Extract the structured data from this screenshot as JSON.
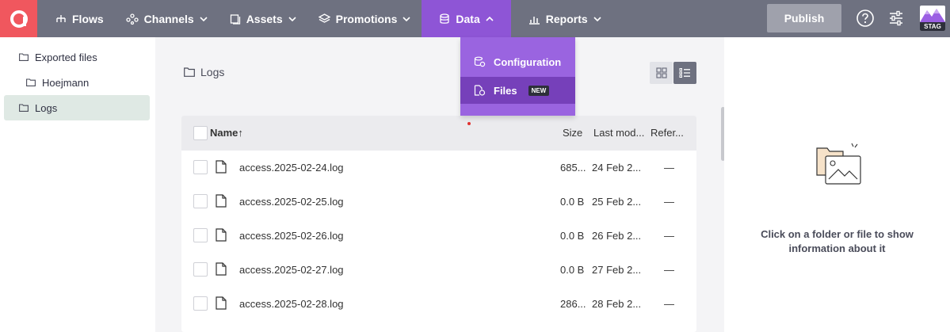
{
  "nav": {
    "items": [
      {
        "label": "Flows",
        "icon": "flows-icon"
      },
      {
        "label": "Channels",
        "icon": "channels-icon"
      },
      {
        "label": "Assets",
        "icon": "assets-icon"
      },
      {
        "label": "Promotions",
        "icon": "promotions-icon"
      },
      {
        "label": "Data",
        "icon": "database-icon",
        "active": true
      },
      {
        "label": "Reports",
        "icon": "reports-icon"
      }
    ],
    "publish_label": "Publish",
    "env_label": "STAG"
  },
  "data_menu": {
    "items": [
      {
        "label": "Configuration",
        "icon": "configuration-icon"
      },
      {
        "label": "Files",
        "icon": "files-icon",
        "badge": "NEW",
        "active": true
      }
    ]
  },
  "sidebar": {
    "items": [
      {
        "label": "Exported files"
      },
      {
        "label": "Hoejmann"
      },
      {
        "label": "Logs",
        "selected": true
      }
    ]
  },
  "main": {
    "breadcrumb": "Logs",
    "columns": {
      "name": "Name",
      "sort_indicator": "↑",
      "size": "Size",
      "last_modified": "Last mod...",
      "references": "Refer..."
    },
    "rows": [
      {
        "name": "access.2025-02-24.log",
        "size": "685...",
        "modified": "24 Feb 2...",
        "refs": "—"
      },
      {
        "name": "access.2025-02-25.log",
        "size": "0.0 B",
        "modified": "25 Feb 2...",
        "refs": "—"
      },
      {
        "name": "access.2025-02-26.log",
        "size": "0.0 B",
        "modified": "26 Feb 2...",
        "refs": "—"
      },
      {
        "name": "access.2025-02-27.log",
        "size": "0.0 B",
        "modified": "27 Feb 2...",
        "refs": "—"
      },
      {
        "name": "access.2025-02-28.log",
        "size": "286...",
        "modified": "28 Feb 2...",
        "refs": "—"
      }
    ]
  },
  "info_panel": {
    "message": "Click on a folder or file to show information about it"
  },
  "colors": {
    "topbar": "#6e7180",
    "accent": "#8e55d6",
    "logo": "#f0575e"
  }
}
